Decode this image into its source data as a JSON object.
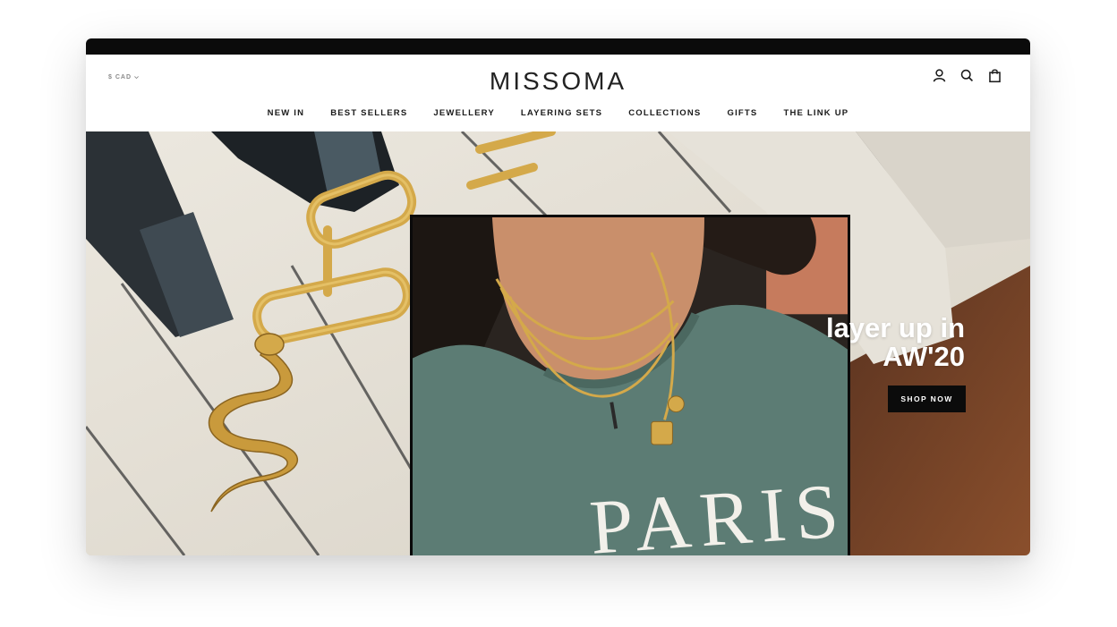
{
  "header": {
    "currency": "$ CAD",
    "logo": "MISSOMA",
    "icons": [
      "account-icon",
      "search-icon",
      "shopping-bag-icon"
    ]
  },
  "nav": {
    "items": [
      "NEW IN",
      "BEST SELLERS",
      "JEWELLERY",
      "LAYERING SETS",
      "COLLECTIONS",
      "GIFTS",
      "THE LINK UP"
    ]
  },
  "hero": {
    "headline_line1": "layer up in",
    "headline_line2": "AW'20",
    "cta": "SHOP NOW",
    "shirt_print": "PARIS"
  },
  "colors": {
    "topbar": "#0b0b0b",
    "button": "#0b0b0b",
    "shirt": "#5a7a72",
    "gold": "#d4a94a"
  }
}
